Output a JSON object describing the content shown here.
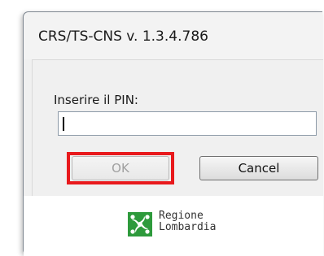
{
  "window": {
    "title": "CRS/TS-CNS v. 1.3.4.786"
  },
  "dialog": {
    "pin_label": "Inserire il PIN:",
    "pin_value": "",
    "ok_label": "OK",
    "cancel_label": "Cancel"
  },
  "footer": {
    "logo_line1": "Regione",
    "logo_line2": "Lombardia",
    "logo_icon": "regione-lombardia-rosa-camuna-icon"
  },
  "colors": {
    "highlight": "#e8191c",
    "logo_green": "#2e9a3c"
  }
}
